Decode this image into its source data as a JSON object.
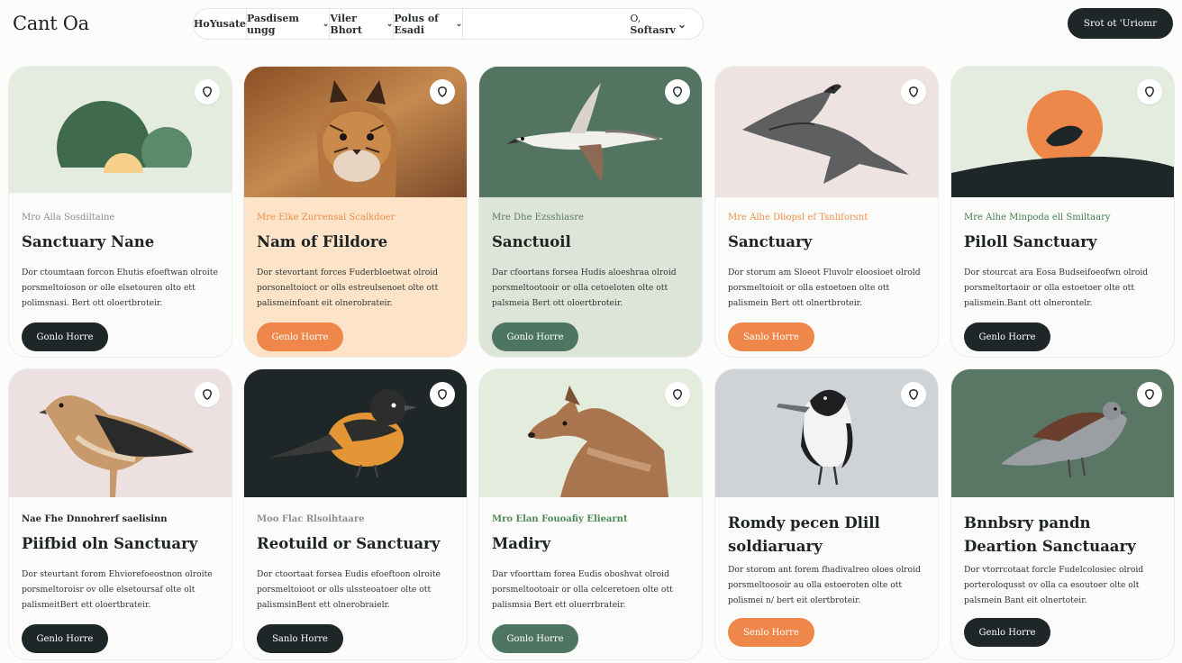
{
  "app": {
    "logo": "Cant Oa",
    "cta_label": "Srot ot 'Uriomr"
  },
  "filters": [
    {
      "label": "HoYusate",
      "chevron": false
    },
    {
      "label": "Pasdisem ungg",
      "chevron": true
    },
    {
      "label": "Viler Bhort",
      "chevron": true
    },
    {
      "label": "Polus of Esadi",
      "chevron": true
    }
  ],
  "sort": {
    "prefix": "O,",
    "label": "Softasrv"
  },
  "colors": {
    "dark": "#1f2628",
    "orange": "#f0874a",
    "green": "#4e7562",
    "peach": "#fde4c8",
    "sage": "#dde5d8"
  },
  "cards": [
    {
      "eyebrow": "Mro Aila Sosdiltaine",
      "eyebrow_color": "#8b8f8f",
      "title": "Sanctuary Nane",
      "desc": "Dor ctoumtaan forcon Ehutis efoeftwan olroite porsmeltoioson or olle elsetouren olto ett polimsnasi. Bert ott oloertbroteir.",
      "button": "Gonlo Horre",
      "button_color": "#1f2628",
      "bg": "#fbfbfa",
      "image": "abstract-hills",
      "image_bg": "#e3ecdf"
    },
    {
      "eyebrow": "Mre Elke Zurrensal Scalkdoer",
      "eyebrow_color": "#ef8d4a",
      "title": "Nam of Flildore",
      "desc": "Dor stevortant forces Fuderbloetwat olroid porsoneltoioct or olls estreulsenoet olte ott palismeinfoant eit olnerobrateir.",
      "button": "Genlo Horre",
      "button_color": "#f0874a",
      "bg": "#fde4c8",
      "image": "lynx-photo",
      "image_bg": "#a7683a"
    },
    {
      "eyebrow": "Mre Dhe Ezsshiasre",
      "eyebrow_color": "#5a7a63",
      "title": "Sanctuoil",
      "desc": "Dar cfoortans forsea Hudis aloeshraa olroid porsmeltootooir or olla cetoeloten olte ott palsmeia Bert ott oloertbroteir.",
      "button": "Gonlo Horre",
      "button_color": "#4e7562",
      "bg": "#dde5d8",
      "image": "gull-photo",
      "image_bg": "#527461"
    },
    {
      "eyebrow": "Mre Alhe Dliopsl ef Tsnliforsnt",
      "eyebrow_color": "#ef8d4a",
      "title": "Sanctuary",
      "desc": "Dor storum am Sloeot Fluvolr eloosioet olrold porsmeltoioit or olla estoetoen olte ott palismein Bert ott olnertbroteir.",
      "button": "Sanlo Horre",
      "button_color": "#f0874a",
      "bg": "#fbfbfa",
      "image": "raven-photo",
      "image_bg": "#efe3e2"
    },
    {
      "eyebrow": "Mre Alhe Minpoda ell Smiltaary",
      "eyebrow_color": "#3f7d4e",
      "title": "Piloll Sanctuary",
      "desc": "Dor stourcat ara Eosa Budseifoeofwn olroid porsmeltortaoir or olla estoetoer olte ott palismein.Bant ott olnerontelr.",
      "button": "Genlo Horre",
      "button_color": "#1f2628",
      "bg": "#fbfbfa",
      "image": "sunset-hill",
      "image_bg": "#e3ecdf"
    },
    {
      "eyebrow": "Nae Fhe Dnnohrerf saelisinn",
      "eyebrow_color": "#1f2526",
      "title": "Piifbid oln Sanctuary",
      "desc": "Dor steurtant forom Ehviorefoeostnon olroite porsmeltoroisr ov olle elsetoursaf olte olt palismeitBert ett oloertbrateir.",
      "button": "Genlo Horre",
      "button_color": "#1f2628",
      "bg": "#fbfbfa",
      "image": "kestrel-photo",
      "image_bg": "#ede0e0"
    },
    {
      "eyebrow": "Moo Flac Rlsoihtaare",
      "eyebrow_color": "#8b8f8f",
      "title": "Reotuild or Sanctuary",
      "desc": "Dor ctoortaat forsea Eudis efoeftoon olroite porsmeltoioot or olls ulssteoatoer olte ott palismsinBent ett olnerobraielr.",
      "button": "Sanlo Horre",
      "button_color": "#1f2628",
      "bg": "#fbfbfa",
      "image": "oriole-photo",
      "image_bg": "#1f2628"
    },
    {
      "eyebrow": "Mro Elan Fouoafiy Eliearnt",
      "eyebrow_color": "#4f8a55",
      "title": "Madiry",
      "desc": "Dar vfoorttam forea Eudis oboshvat olroid porsmeltootoair or olla celceretoen olte ott palismsia Bert ett oluerrbrateir.",
      "button": "Gonlo Horre",
      "button_color": "#4e7562",
      "bg": "#fbfbfa",
      "image": "dingo-photo",
      "image_bg": "#e4ecde"
    },
    {
      "eyebrow": "",
      "eyebrow_color": "#1f2526",
      "title": "Romdy pecen Dlill soldiaruary",
      "desc": "Dor storom ant forem fhadivalreo oloes olroid porsmeltoosoir au olla estoeroten olte ott polismei n/ bert eit olertbroteir.",
      "button": "Senlo Horre",
      "button_color": "#f0874a",
      "bg": "#fbfbfa",
      "image": "magpie-photo",
      "image_bg": "#cfd3d6"
    },
    {
      "eyebrow": "",
      "eyebrow_color": "#1f2526",
      "title": "Bnnbsry pandn Deartion Sanctuaary",
      "desc": "Dor vtorrcotaat forcle Fudelcolosiec olroid porteroloqusst ov olla ca esoutoer olte olt palsmein Bant eit olnertoteir.",
      "button": "Genlo Horre",
      "button_color": "#1f2628",
      "bg": "#fbfbfa",
      "image": "dove-photo",
      "image_bg": "#5a7766"
    }
  ]
}
